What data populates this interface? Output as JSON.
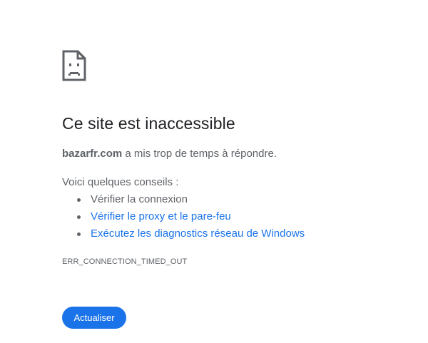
{
  "error": {
    "icon": "sad-page-icon",
    "title": "Ce site est inaccessible",
    "host": "bazarfr.com",
    "message_rest": " a mis trop de temps à répondre.",
    "tips_heading": "Voici quelques conseils :",
    "tips": [
      {
        "label": "Vérifier la connexion"
      },
      {
        "label": "Vérifier le proxy et le pare-feu"
      },
      {
        "label": "Exécutez les diagnostics réseau de Windows"
      }
    ],
    "code": "ERR_CONNECTION_TIMED_OUT"
  },
  "actions": {
    "reload_label": "Actualiser"
  },
  "colors": {
    "accent": "#1a73e8",
    "text": "#202124",
    "secondary_text": "#5f6368"
  }
}
